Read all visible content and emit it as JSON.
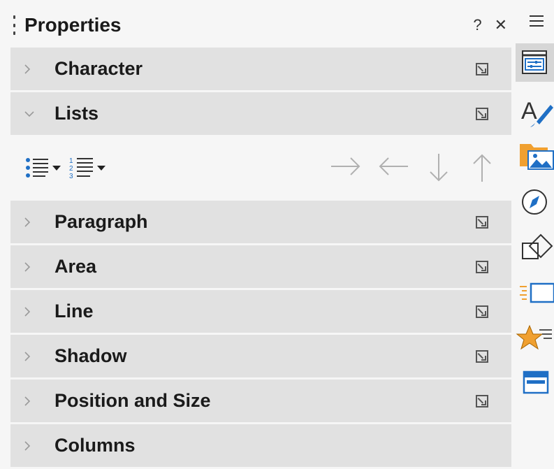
{
  "panel": {
    "title": "Properties",
    "help_label": "?",
    "close_label": "✕"
  },
  "sections": [
    {
      "label": "Character",
      "expanded": false
    },
    {
      "label": "Lists",
      "expanded": true
    },
    {
      "label": "Paragraph",
      "expanded": false
    },
    {
      "label": "Area",
      "expanded": false
    },
    {
      "label": "Line",
      "expanded": false
    },
    {
      "label": "Shadow",
      "expanded": false
    },
    {
      "label": "Position and Size",
      "expanded": false
    },
    {
      "label": "Columns",
      "expanded": false
    }
  ],
  "lists": {
    "ordered_numbers": [
      "1",
      "2",
      "3"
    ]
  },
  "sidebar_tabs": [
    {
      "name": "properties",
      "active": true
    },
    {
      "name": "styles"
    },
    {
      "name": "gallery"
    },
    {
      "name": "navigator"
    },
    {
      "name": "shapes"
    },
    {
      "name": "slide-transition"
    },
    {
      "name": "animation"
    },
    {
      "name": "master-slides"
    }
  ],
  "colors": {
    "section_bg": "#e1e1e1",
    "panel_bg": "#f6f6f6",
    "accent_blue": "#1f6fc5",
    "accent_orange": "#f0a030"
  }
}
